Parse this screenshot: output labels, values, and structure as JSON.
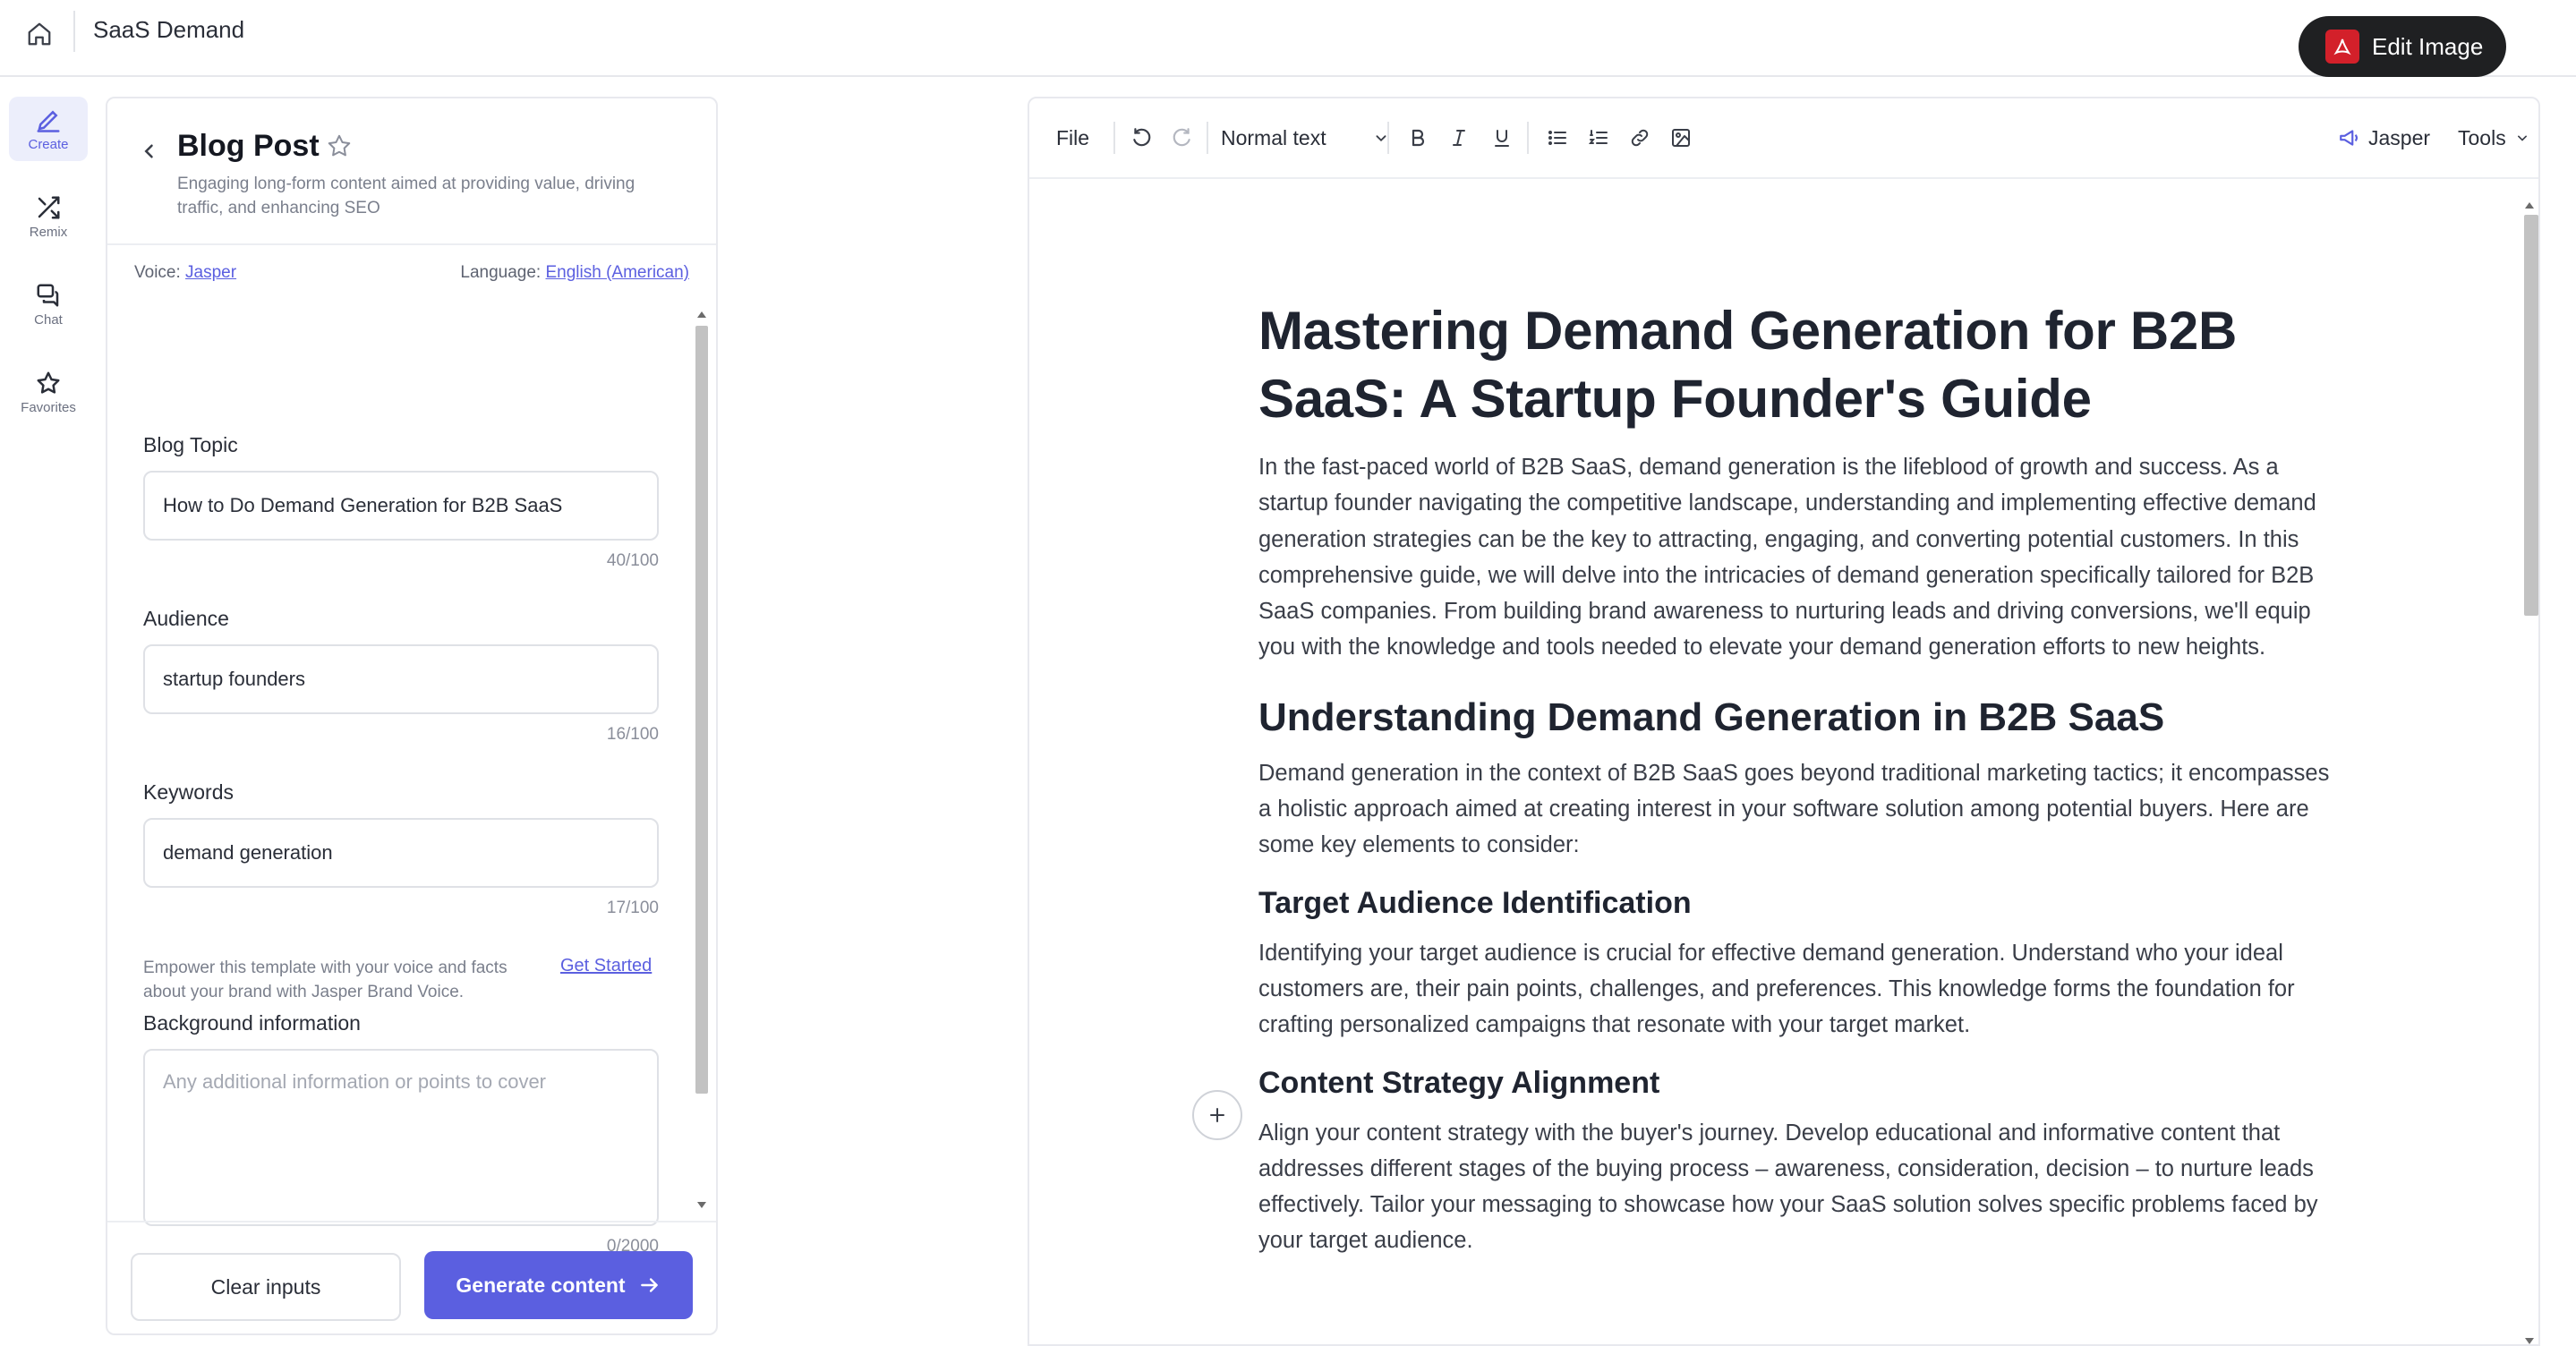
{
  "header": {
    "app_title": "SaaS Demand",
    "edit_image_label": "Edit Image"
  },
  "rail": {
    "items": [
      {
        "label": "Create",
        "icon": "pencil-icon",
        "active": true
      },
      {
        "label": "Remix",
        "icon": "shuffle-icon",
        "active": false
      },
      {
        "label": "Chat",
        "icon": "chat-icon",
        "active": false
      },
      {
        "label": "Favorites",
        "icon": "star-icon",
        "active": false
      }
    ]
  },
  "panel": {
    "title": "Blog Post",
    "description": "Engaging long-form content aimed at providing value, driving traffic, and enhancing SEO",
    "voice_label": "Voice:",
    "voice_value": "Jasper",
    "language_label": "Language:",
    "language_value": "English (American)",
    "fields": [
      {
        "label": "Blog Topic",
        "value": "How to Do Demand Generation for B2B SaaS",
        "count": "40/100"
      },
      {
        "label": "Audience",
        "value": "startup founders",
        "count": "16/100"
      },
      {
        "label": "Keywords",
        "value": "demand generation",
        "count": "17/100"
      }
    ],
    "brand_note": "Empower this template with your voice and facts about your brand with Jasper Brand Voice.",
    "get_started": "Get Started",
    "background": {
      "label": "Background information",
      "placeholder": "Any additional information or points to cover",
      "count": "0/2000"
    },
    "clear_label": "Clear inputs",
    "generate_label": "Generate content"
  },
  "toolbar": {
    "file": "File",
    "text_style": "Normal text",
    "jasper": "Jasper",
    "tools": "Tools"
  },
  "document": {
    "title": "Mastering Demand Generation for B2B SaaS: A Startup Founder's Guide",
    "intro": "In the fast-paced world of B2B SaaS, demand generation is the lifeblood of growth and success. As a startup founder navigating the competitive landscape, understanding and implementing effective demand generation strategies can be the key to attracting, engaging, and converting potential customers. In this comprehensive guide, we will delve into the intricacies of demand generation specifically tailored for B2B SaaS companies. From building brand awareness to nurturing leads and driving conversions, we'll equip you with the knowledge and tools needed to elevate your demand generation efforts to new heights.",
    "section_heading": "Understanding Demand Generation in B2B SaaS",
    "section_text": "Demand generation in the context of B2B SaaS goes beyond traditional marketing tactics; it encompasses a holistic approach aimed at creating interest in your software solution among potential buyers. Here are some key elements to consider:",
    "sub1_heading": "Target Audience Identification",
    "sub1_text": "Identifying your target audience is crucial for effective demand generation. Understand who your ideal customers are, their pain points, challenges, and preferences. This knowledge forms the foundation for crafting personalized campaigns that resonate with your target market.",
    "sub2_heading": "Content Strategy Alignment",
    "sub2_text": "Align your content strategy with the buyer's journey. Develop educational and informative content that addresses different stages of the buying process – awareness, consideration, decision – to nurture leads effectively. Tailor your messaging to showcase how your SaaS solution solves specific problems faced by your target audience."
  }
}
